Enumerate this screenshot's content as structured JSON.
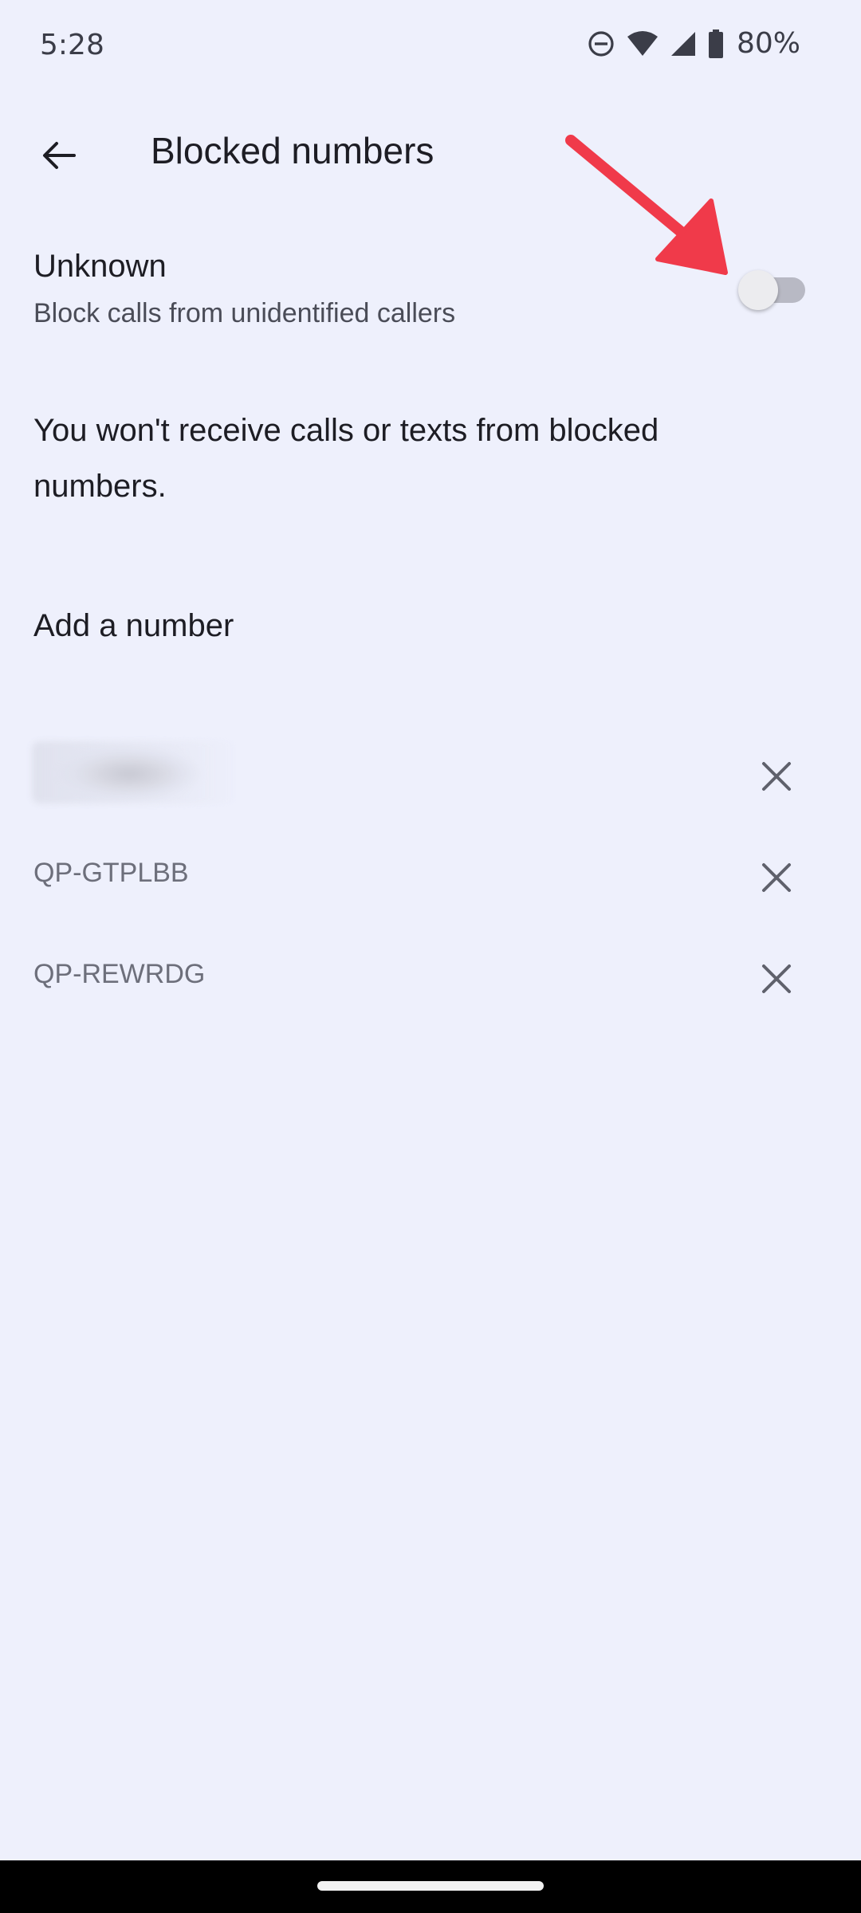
{
  "status_bar": {
    "time": "5:28",
    "battery_percent": "80%",
    "icons": [
      "do-not-disturb-icon",
      "wifi-icon",
      "cellular-signal-icon",
      "battery-icon"
    ]
  },
  "app_bar": {
    "back_icon": "arrow-left-icon",
    "title": "Blocked numbers"
  },
  "unknown_setting": {
    "title": "Unknown",
    "subtitle": "Block calls from unidentified callers",
    "enabled": false
  },
  "info_text": "You won't receive calls or texts from blocked numbers.",
  "add_number_label": "Add a number",
  "blocked_numbers": [
    {
      "value": "",
      "redacted": true
    },
    {
      "value": "QP-GTPLBB",
      "redacted": false
    },
    {
      "value": "QP-REWRDG",
      "redacted": false
    }
  ],
  "colors": {
    "background": "#eef0fc",
    "annotation_arrow": "#f03a4a",
    "toggle_track_off": "#b8b9c4",
    "secondary_text": "#6d6f7b"
  }
}
